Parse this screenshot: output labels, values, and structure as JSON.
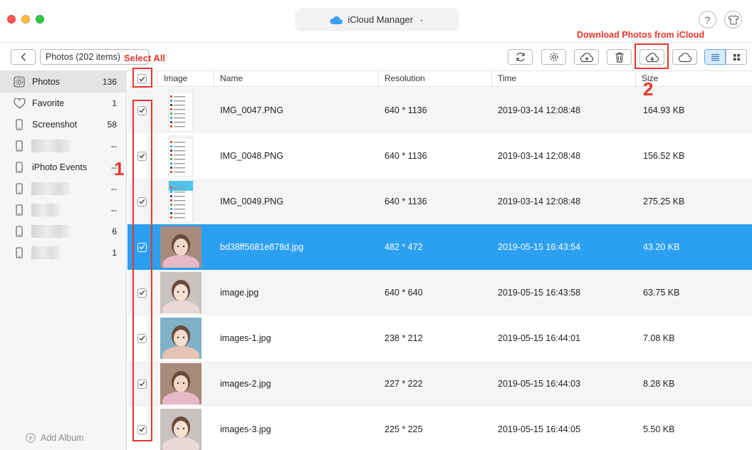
{
  "window": {
    "title": "iCloud Manager"
  },
  "toolbar": {
    "breadcrumb": "Photos (202 items)"
  },
  "sidebar": {
    "items": [
      {
        "label": "Photos",
        "count": "136",
        "icon": "photos-icon",
        "hidden": false
      },
      {
        "label": "Favorite",
        "count": "1",
        "icon": "heart-icon",
        "hidden": false
      },
      {
        "label": "Screenshot",
        "count": "58",
        "icon": "phone-icon",
        "hidden": false
      },
      {
        "label": "",
        "count": "--",
        "icon": "phone-icon",
        "hidden": true
      },
      {
        "label": "iPhoto Events",
        "count": "--",
        "icon": "phone-icon",
        "hidden": false
      },
      {
        "label": "",
        "count": "--",
        "icon": "phone-icon",
        "hidden": true
      },
      {
        "label": "",
        "count": "--",
        "icon": "phone-icon",
        "hidden": true
      },
      {
        "label": "",
        "count": "6",
        "icon": "phone-icon",
        "hidden": true
      },
      {
        "label": "",
        "count": "1",
        "icon": "phone-icon",
        "hidden": true
      }
    ],
    "add_album": "Add Album"
  },
  "table": {
    "columns": [
      "Image",
      "Name",
      "Resolution",
      "Time",
      "Size"
    ],
    "rows": [
      {
        "name": "IMG_0047.PNG",
        "resolution": "640 * 1136",
        "time": "2019-03-14 12:08:48",
        "size": "164.93 KB",
        "thumb": "screenshot"
      },
      {
        "name": "IMG_0048.PNG",
        "resolution": "640 * 1136",
        "time": "2019-03-14 12:08:48",
        "size": "156.52 KB",
        "thumb": "screenshot"
      },
      {
        "name": "IMG_0049.PNG",
        "resolution": "640 * 1136",
        "time": "2019-03-14 12:08:48",
        "size": "275.25 KB",
        "thumb": "screenshot-blue"
      },
      {
        "name": "bd38ff5681e878d.jpg",
        "resolution": "482 * 472",
        "time": "2019-05-15 16:43:54",
        "size": "43.20 KB",
        "thumb": "girl-pink"
      },
      {
        "name": "image.jpg",
        "resolution": "640 * 640",
        "time": "2019-05-15 16:43:58",
        "size": "63.75 KB",
        "thumb": "girl-light"
      },
      {
        "name": "images-1.jpg",
        "resolution": "238 * 212",
        "time": "2019-05-15 16:44:01",
        "size": "7.08 KB",
        "thumb": "girl-blue"
      },
      {
        "name": "images-2.jpg",
        "resolution": "227 * 222",
        "time": "2019-05-15 16:44:03",
        "size": "8.28 KB",
        "thumb": "girl-pink"
      },
      {
        "name": "images-3.jpg",
        "resolution": "225 * 225",
        "time": "2019-05-15 16:44:05",
        "size": "5.50 KB",
        "thumb": "girl-light"
      }
    ]
  },
  "annotations": {
    "select_all": "Select All",
    "step1": "1",
    "step2": "2",
    "download": "Download Photos from iCloud"
  },
  "colors": {
    "selection": "#2b9ff0",
    "annotation": "#e8362b",
    "icloud_blue": "#3aa0f3"
  }
}
